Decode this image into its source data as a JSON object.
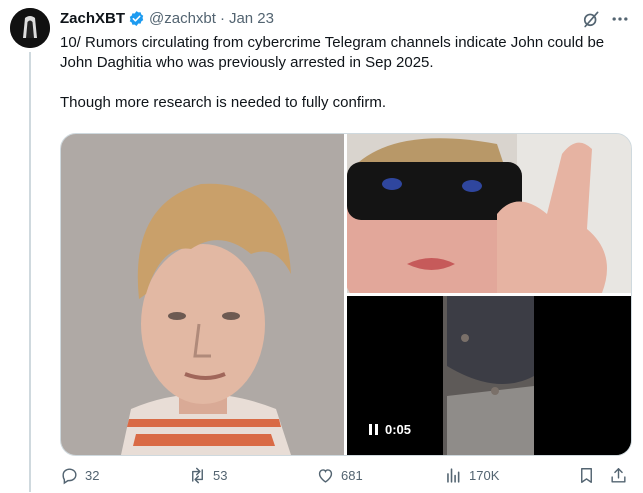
{
  "tweet": {
    "author_name": "ZachXBT",
    "handle": "@zachxbt",
    "separator": "·",
    "date": "Jan 23",
    "text_line1": "10/ Rumors circulating from cybercrime Telegram channels indicate John could be John Daghitia who was previously arrested in Sep 2025.",
    "text_line2": "Though more research is needed to fully confirm."
  },
  "media": {
    "video_time": "0:05"
  },
  "actions": {
    "replies": "32",
    "reposts": "53",
    "likes": "681",
    "views": "170K"
  },
  "colors": {
    "text": "#0f1419",
    "muted": "#536471",
    "verified": "#1d9bf0",
    "border": "#cfd9de"
  },
  "icons": [
    "verified-badge-icon",
    "grok-icon",
    "more-icon",
    "reply-icon",
    "retweet-icon",
    "like-icon",
    "views-icon",
    "bookmark-icon",
    "share-icon",
    "pause-icon"
  ]
}
